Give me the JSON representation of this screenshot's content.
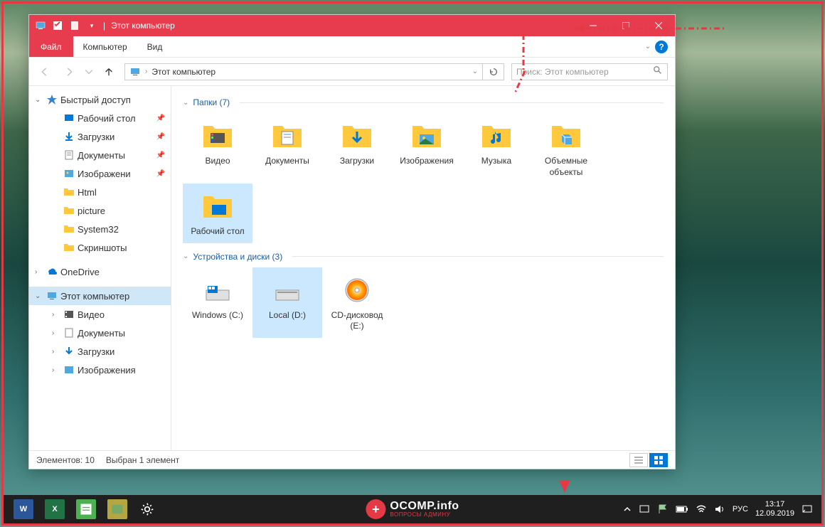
{
  "window": {
    "title": "Этот компьютер"
  },
  "ribbon": {
    "file": "Файл",
    "tab_computer": "Компьютер",
    "tab_view": "Вид"
  },
  "nav": {
    "address": "Этот компьютер",
    "search_placeholder": "Поиск: Этот компьютер"
  },
  "sidebar": {
    "quick_access": "Быстрый доступ",
    "qa": {
      "desktop": "Рабочий стол",
      "downloads": "Загрузки",
      "documents": "Документы",
      "pictures": "Изображени",
      "html": "Html",
      "picture": "picture",
      "system32": "System32",
      "screenshots": "Скриншоты"
    },
    "onedrive": "OneDrive",
    "this_pc": "Этот компьютер",
    "tp": {
      "videos": "Видео",
      "documents": "Документы",
      "downloads": "Загрузки",
      "pictures": "Изображения"
    }
  },
  "content": {
    "group_folders": "Папки (7)",
    "folders": {
      "videos": "Видео",
      "documents": "Документы",
      "downloads": "Загрузки",
      "pictures": "Изображения",
      "music": "Музыка",
      "objects3d": "Объемные объекты",
      "desktop": "Рабочий стол"
    },
    "group_drives": "Устройства и диски (3)",
    "drives": {
      "c": "Windows (C:)",
      "d": "Local (D:)",
      "e": "CD-дисковод (E:)"
    }
  },
  "status": {
    "elements": "Элементов: 10",
    "selected": "Выбран 1 элемент"
  },
  "taskbar": {
    "word": "W",
    "excel": "X",
    "ocomp_main": "OCOMP.info",
    "ocomp_sub": "ВОПРОСЫ АДМИНУ",
    "lang": "РУС",
    "time": "13:17",
    "date": "12.09.2019"
  }
}
